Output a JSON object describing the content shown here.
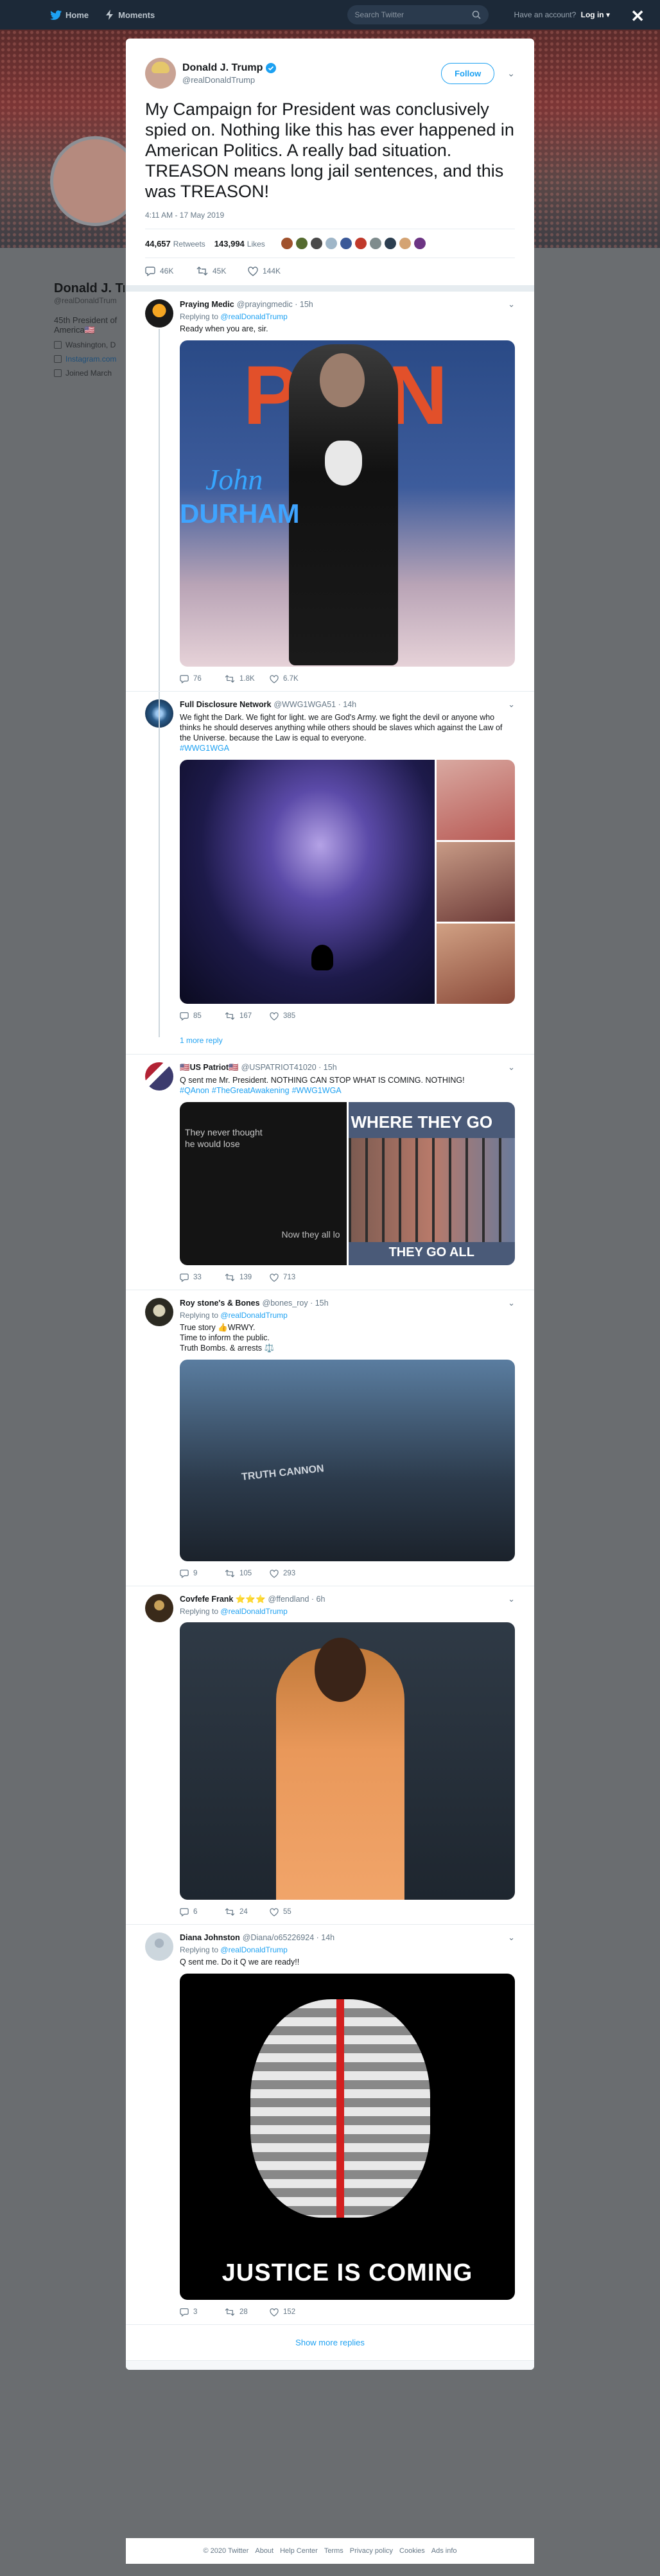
{
  "nav": {
    "home": "Home",
    "moments": "Moments",
    "search_placeholder": "Search Twitter",
    "have_account": "Have an account?",
    "login": "Log in"
  },
  "profile": {
    "name": "Donald J. Tr",
    "handle": "@realDonaldTrum",
    "bio_line1": "45th President of",
    "bio_line2": "America🇺🇸",
    "location": "Washington, D",
    "url": "Instagram.com",
    "joined": "Joined March"
  },
  "tweet": {
    "name": "Donald J. Trump",
    "handle": "@realDonaldTrump",
    "follow_label": "Follow",
    "text": "My Campaign for President was conclusively spied on. Nothing like this has ever happened in American Politics. A really bad situation. TREASON means long jail sentences, and this was TREASON!",
    "time": "4:11 AM - 17 May 2019",
    "retweets_count": "44,657",
    "retweets_label": "Retweets",
    "likes_count": "143,994",
    "likes_label": "Likes",
    "reply_count": "46K",
    "retweet_count": "45K",
    "like_count": "144K"
  },
  "replies": [
    {
      "name": "Praying Medic",
      "handle": "@prayingmedic · 15h",
      "replying_prefix": "Replying to",
      "replying_to": "@realDonaldTrump",
      "text": "Ready when you are, sir.",
      "media_text": [
        "PAIN",
        "John",
        "DURHAM"
      ],
      "replies": "76",
      "retweets": "1.8K",
      "likes": "6.7K"
    },
    {
      "name": "Full Disclosure Network",
      "handle": "@WWG1WGA51 · 14h",
      "text": "We fight the Dark. We fight for light. we are God's Army. we fight the devil or anyone who thinks he should deserves anything while others should be slaves which against the Law of the Universe. because the Law is equal to everyone.",
      "tags": [
        "#WWG1WGA"
      ],
      "replies": "85",
      "retweets": "167",
      "likes": "385",
      "more_replies": "1 more reply"
    },
    {
      "name": "🇺🇸US Patriot🇺🇸",
      "handle": "@USPATRIOT41020 · 15h",
      "text": "Q sent me Mr. President. NOTHING CAN STOP WHAT IS COMING. NOTHING!",
      "tags": [
        "#QAnon",
        "#TheGreatAwakening",
        "#WWG1WGA"
      ],
      "media_text": [
        "They never thought",
        "he would lose",
        "Now they all lo",
        "WHERE THEY GO",
        "THEY GO ALL"
      ],
      "replies": "33",
      "retweets": "139",
      "likes": "713"
    },
    {
      "name": "Roy stone's & Bones",
      "handle": "@bones_roy · 15h",
      "replying_prefix": "Replying to",
      "replying_to": "@realDonaldTrump",
      "text": "True story 👍WRWY.\nTime to inform the public.\nTruth Bombs. & arrests ⚖️",
      "media_text": [
        "TRUTH CANNON"
      ],
      "replies": "9",
      "retweets": "105",
      "likes": "293"
    },
    {
      "name": "Covfefe Frank ⭐⭐⭐",
      "handle": "@ffendland · 6h",
      "replying_prefix": "Replying to",
      "replying_to": "@realDonaldTrump",
      "replies": "6",
      "retweets": "24",
      "likes": "55"
    },
    {
      "name": "Diana Johnston",
      "handle": "@Diana/o65226924 · 14h",
      "replying_prefix": "Replying to",
      "replying_to": "@realDonaldTrump",
      "text": "Q sent me. Do it Q we are ready!!",
      "media_text": [
        "JUSTICE IS COMING"
      ],
      "replies": "3",
      "retweets": "28",
      "likes": "152"
    }
  ],
  "show_more": "Show more replies",
  "footer": [
    "© 2020 Twitter",
    "About",
    "Help Center",
    "Terms",
    "Privacy policy",
    "Cookies",
    "Ads info"
  ],
  "colors": {
    "accent": "#1da1f2",
    "nav_bg": "#1c2938",
    "like_pink": "#e0245e"
  }
}
